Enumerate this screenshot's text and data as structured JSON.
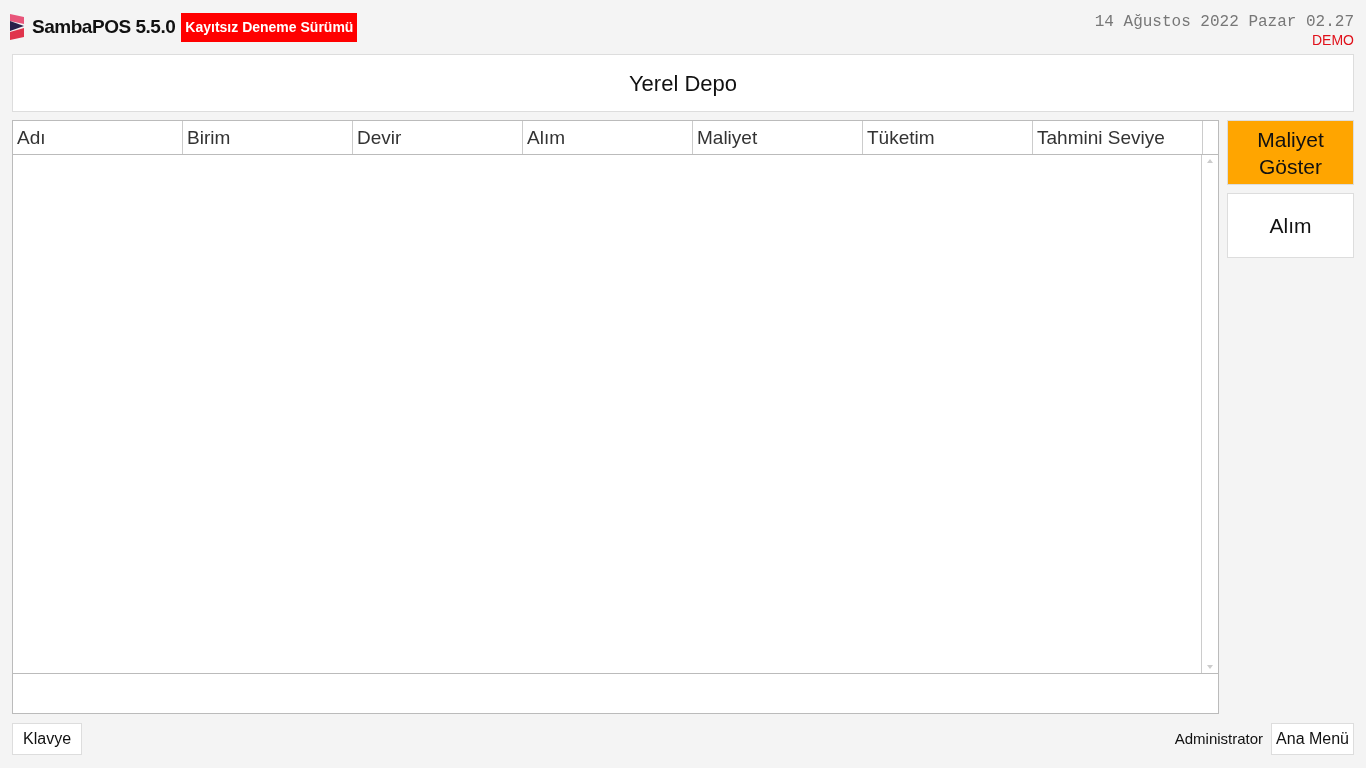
{
  "header": {
    "app_name": "SambaPOS 5.5.0",
    "badge": "Kayıtsız Deneme Sürümü",
    "datetime": "14 Ağustos 2022 Pazar 02.27",
    "mode": "DEMO"
  },
  "title": "Yerel Depo",
  "table": {
    "columns": [
      "Adı",
      "Birim",
      "Devir",
      "Alım",
      "Maliyet",
      "Tüketim",
      "Tahmini Seviye"
    ]
  },
  "side_buttons": [
    {
      "label": "Maliyet Göster",
      "color": "#ffa500"
    },
    {
      "label": "Alım",
      "color": "#ffffff"
    }
  ],
  "footer": {
    "keyboard_button": "Klavye",
    "user": "Administrator",
    "menu_button": "Ana Menü"
  }
}
